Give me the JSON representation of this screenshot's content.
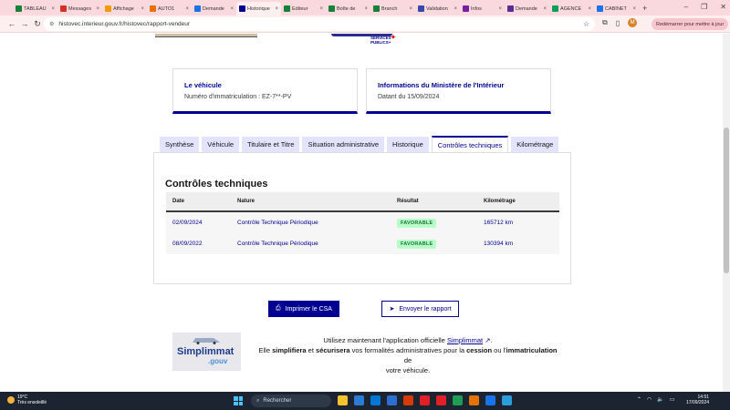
{
  "browser": {
    "tabs": [
      {
        "label": "TABLEAU",
        "color": "#188038",
        "glyph": "▦",
        "active": false
      },
      {
        "label": "Messages",
        "color": "#d93025",
        "glyph": "✉",
        "active": false
      },
      {
        "label": "Affichage",
        "color": "#f29900",
        "glyph": "▣",
        "active": false
      },
      {
        "label": "AUTO1",
        "color": "#e8710a",
        "glyph": "◆",
        "active": false
      },
      {
        "label": "Demande",
        "color": "#1a73e8",
        "glyph": "▤",
        "active": false
      },
      {
        "label": "Historique",
        "color": "#000091",
        "glyph": "◉",
        "active": true
      },
      {
        "label": "Editeur",
        "color": "#188038",
        "glyph": "▦",
        "active": false
      },
      {
        "label": "Boîte de",
        "color": "#188038",
        "glyph": "▦",
        "active": false
      },
      {
        "label": "Branch",
        "color": "#188038",
        "glyph": "▦",
        "active": false
      },
      {
        "label": "Validation",
        "color": "#3949ab",
        "glyph": "▤",
        "active": false
      },
      {
        "label": "Infos",
        "color": "#7b1fa2",
        "glyph": "◉",
        "active": false
      },
      {
        "label": "Demande",
        "color": "#5c2d91",
        "glyph": "▣",
        "active": false
      },
      {
        "label": "AGENCE",
        "color": "#0f9d58",
        "glyph": "◆",
        "active": false
      },
      {
        "label": "CABINET",
        "color": "#1a73e8",
        "glyph": "◉",
        "active": false
      }
    ],
    "url": "histovec.interieur.gouv.fr/histovec/rapport-vendeur",
    "avatar_letter": "M",
    "relaunch_label": "Redémarrer pour mettre à jour"
  },
  "header_logo": {
    "line1": "SERVICES",
    "line2": "PUBLICS+"
  },
  "vehicle_card": {
    "title": "Le véhicule",
    "text": "Numéro d'immatriculation : EZ-7**-PV"
  },
  "ministry_card": {
    "title": "Informations du Ministère de l'Intérieur",
    "text": "Datant du 15/09/2024"
  },
  "report_tabs": [
    {
      "label": "Synthèse",
      "active": false
    },
    {
      "label": "Véhicule",
      "active": false
    },
    {
      "label": "Titulaire et Titre",
      "active": false
    },
    {
      "label": "Situation administrative",
      "active": false
    },
    {
      "label": "Historique",
      "active": false
    },
    {
      "label": "Contrôles techniques",
      "active": true
    },
    {
      "label": "Kilométrage",
      "active": false
    }
  ],
  "controls": {
    "heading": "Contrôles techniques",
    "columns": [
      "Date",
      "Nature",
      "Résultat",
      "Kilométrage"
    ],
    "rows": [
      {
        "date": "02/09/2024",
        "nature": "Contrôle Technique Périodique",
        "result": "FAVORABLE",
        "km": "165712 km"
      },
      {
        "date": "08/09/2022",
        "nature": "Contrôle Technique Périodique",
        "result": "FAVORABLE",
        "km": "130394 km"
      }
    ]
  },
  "actions": {
    "print_label": "Imprimer le CSA",
    "send_label": "Envoyer le rapport"
  },
  "simplimmat": {
    "logo_word1": "Simplimmat",
    "logo_word2": ".gouv",
    "line1_prefix": "Utilisez maintenant l'application officielle",
    "link": "Simplimmat",
    "line1_suffix": ".",
    "l2_a": "Elle ",
    "l2_b": "simplifiera",
    "l2_c": " et ",
    "l2_d": "sécurisera",
    "l2_e": " vos formalités administratives pour la ",
    "l2_f": "cession",
    "l2_g": " ou l'",
    "l2_h": "immatriculation",
    "l2_i": " de",
    "line3": "votre véhicule."
  },
  "taskbar": {
    "temp": "19°C",
    "weather": "Très ensoleillé",
    "search_placeholder": "Rechercher",
    "time": "14:51",
    "date": "17/09/2024",
    "apps": [
      "#f4c430",
      "#2b7cd3",
      "#0078d4",
      "#2d6fd1",
      "#d83b01",
      "#e11f26",
      "#e11f26",
      "#1f9d55",
      "#e37400",
      "#1a73e8",
      "#2d9cdb"
    ]
  }
}
